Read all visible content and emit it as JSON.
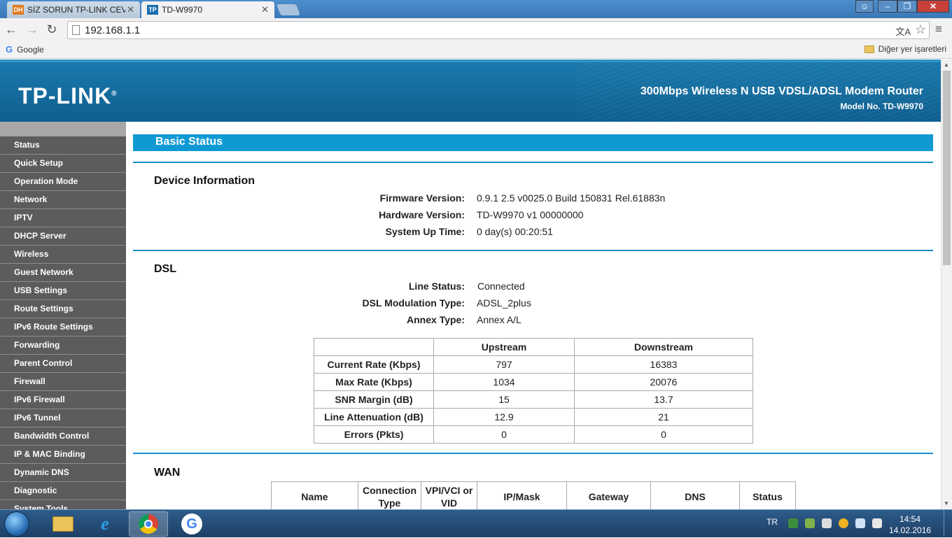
{
  "browser": {
    "tabs": [
      {
        "label": "SİZ SORUN TP-LINK CEVAP",
        "favicon": "DH",
        "active": false
      },
      {
        "label": "TD-W9970",
        "favicon": "TP",
        "active": true
      }
    ],
    "url": "192.168.1.1",
    "bookmarks": {
      "google": "Google",
      "other": "Diğer yer işaretleri"
    }
  },
  "router": {
    "logo": "TP-LINK",
    "product_title": "300Mbps Wireless N USB VDSL/ADSL Modem Router",
    "model": "Model No. TD-W9970",
    "menu": [
      "Status",
      "Quick Setup",
      "Operation Mode",
      "Network",
      "IPTV",
      "DHCP Server",
      "Wireless",
      "Guest Network",
      "USB Settings",
      "Route Settings",
      "IPv6 Route Settings",
      "Forwarding",
      "Parent Control",
      "Firewall",
      "IPv6 Firewall",
      "IPv6 Tunnel",
      "Bandwidth Control",
      "IP & MAC Binding",
      "Dynamic DNS",
      "Diagnostic",
      "System Tools"
    ],
    "page_title": "Basic Status",
    "device": {
      "title": "Device Information",
      "firmware_label": "Firmware Version:",
      "firmware": "0.9.1 2.5 v0025.0 Build 150831 Rel.61883n",
      "hardware_label": "Hardware Version:",
      "hardware": "TD-W9970 v1 00000000",
      "uptime_label": "System Up Time:",
      "uptime": "0 day(s) 00:20:51"
    },
    "dsl": {
      "title": "DSL",
      "line_status_label": "Line Status:",
      "line_status": "Connected",
      "modulation_label": "DSL Modulation Type:",
      "modulation": "ADSL_2plus",
      "annex_label": "Annex Type:",
      "annex": "Annex A/L",
      "table": {
        "headers": [
          "",
          "Upstream",
          "Downstream"
        ],
        "rows": [
          {
            "label": "Current Rate (Kbps)",
            "up": "797",
            "down": "16383"
          },
          {
            "label": "Max Rate (Kbps)",
            "up": "1034",
            "down": "20076"
          },
          {
            "label": "SNR Margin (dB)",
            "up": "15",
            "down": "13.7"
          },
          {
            "label": "Line Attenuation (dB)",
            "up": "12.9",
            "down": "21"
          },
          {
            "label": "Errors (Pkts)",
            "up": "0",
            "down": "0"
          }
        ]
      }
    },
    "wan": {
      "title": "WAN",
      "headers": [
        "Name",
        "Connection Type",
        "VPI/VCI or VID",
        "IP/Mask",
        "Gateway",
        "DNS",
        "Status"
      ]
    }
  },
  "taskbar": {
    "lang": "TR",
    "time": "14:54",
    "date": "14.02.2016"
  }
}
